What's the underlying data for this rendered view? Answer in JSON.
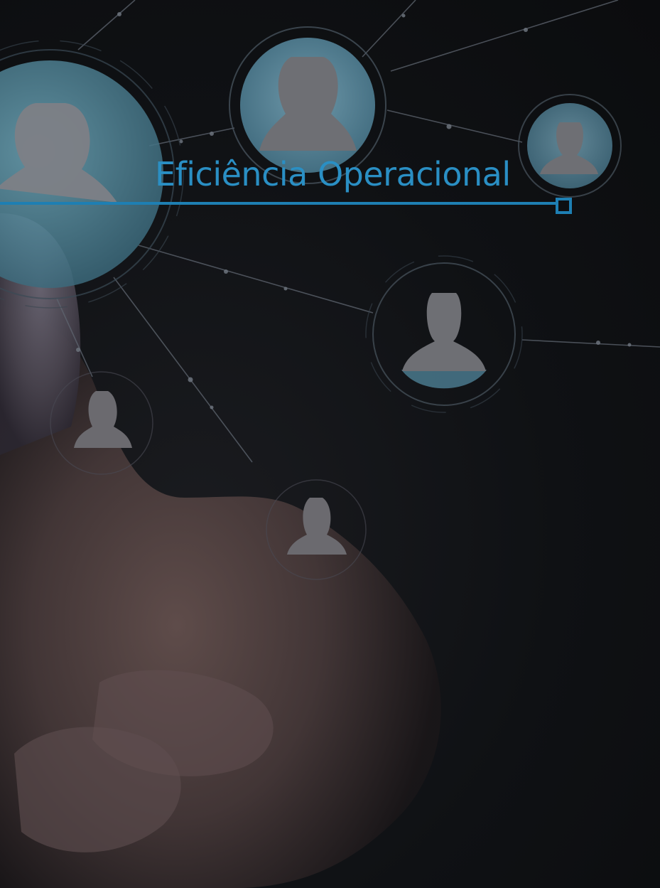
{
  "banner": {
    "title": "Eficiência Operacional",
    "accent_color": "#1e7fb3",
    "text_color": "#2a8fc4"
  },
  "background": {
    "description_icon": "network-people-icons",
    "theme_color": "#0d0f12"
  }
}
